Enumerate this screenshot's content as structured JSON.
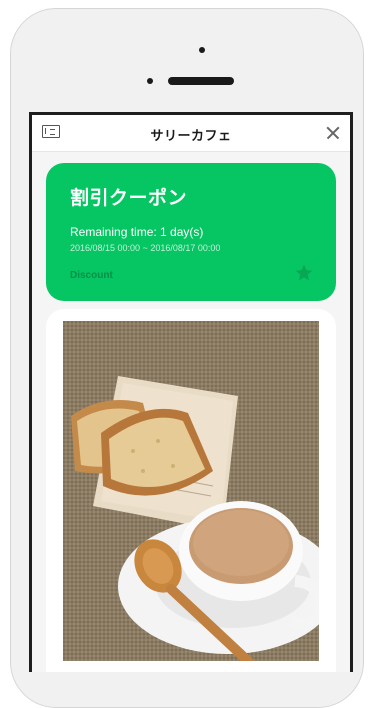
{
  "header": {
    "title": "サリーカフェ"
  },
  "coupon": {
    "title": "割引クーポン",
    "remaining": "Remaining time: 1 day(s)",
    "period": "2016/08/15 00:00 ~ 2016/08/17 00:00",
    "type": "Discount"
  },
  "colors": {
    "accent": "#06c563",
    "background": "#f5f5f5"
  },
  "icons": {
    "left": "screen-icon",
    "close": "close-icon",
    "star": "star-icon"
  }
}
